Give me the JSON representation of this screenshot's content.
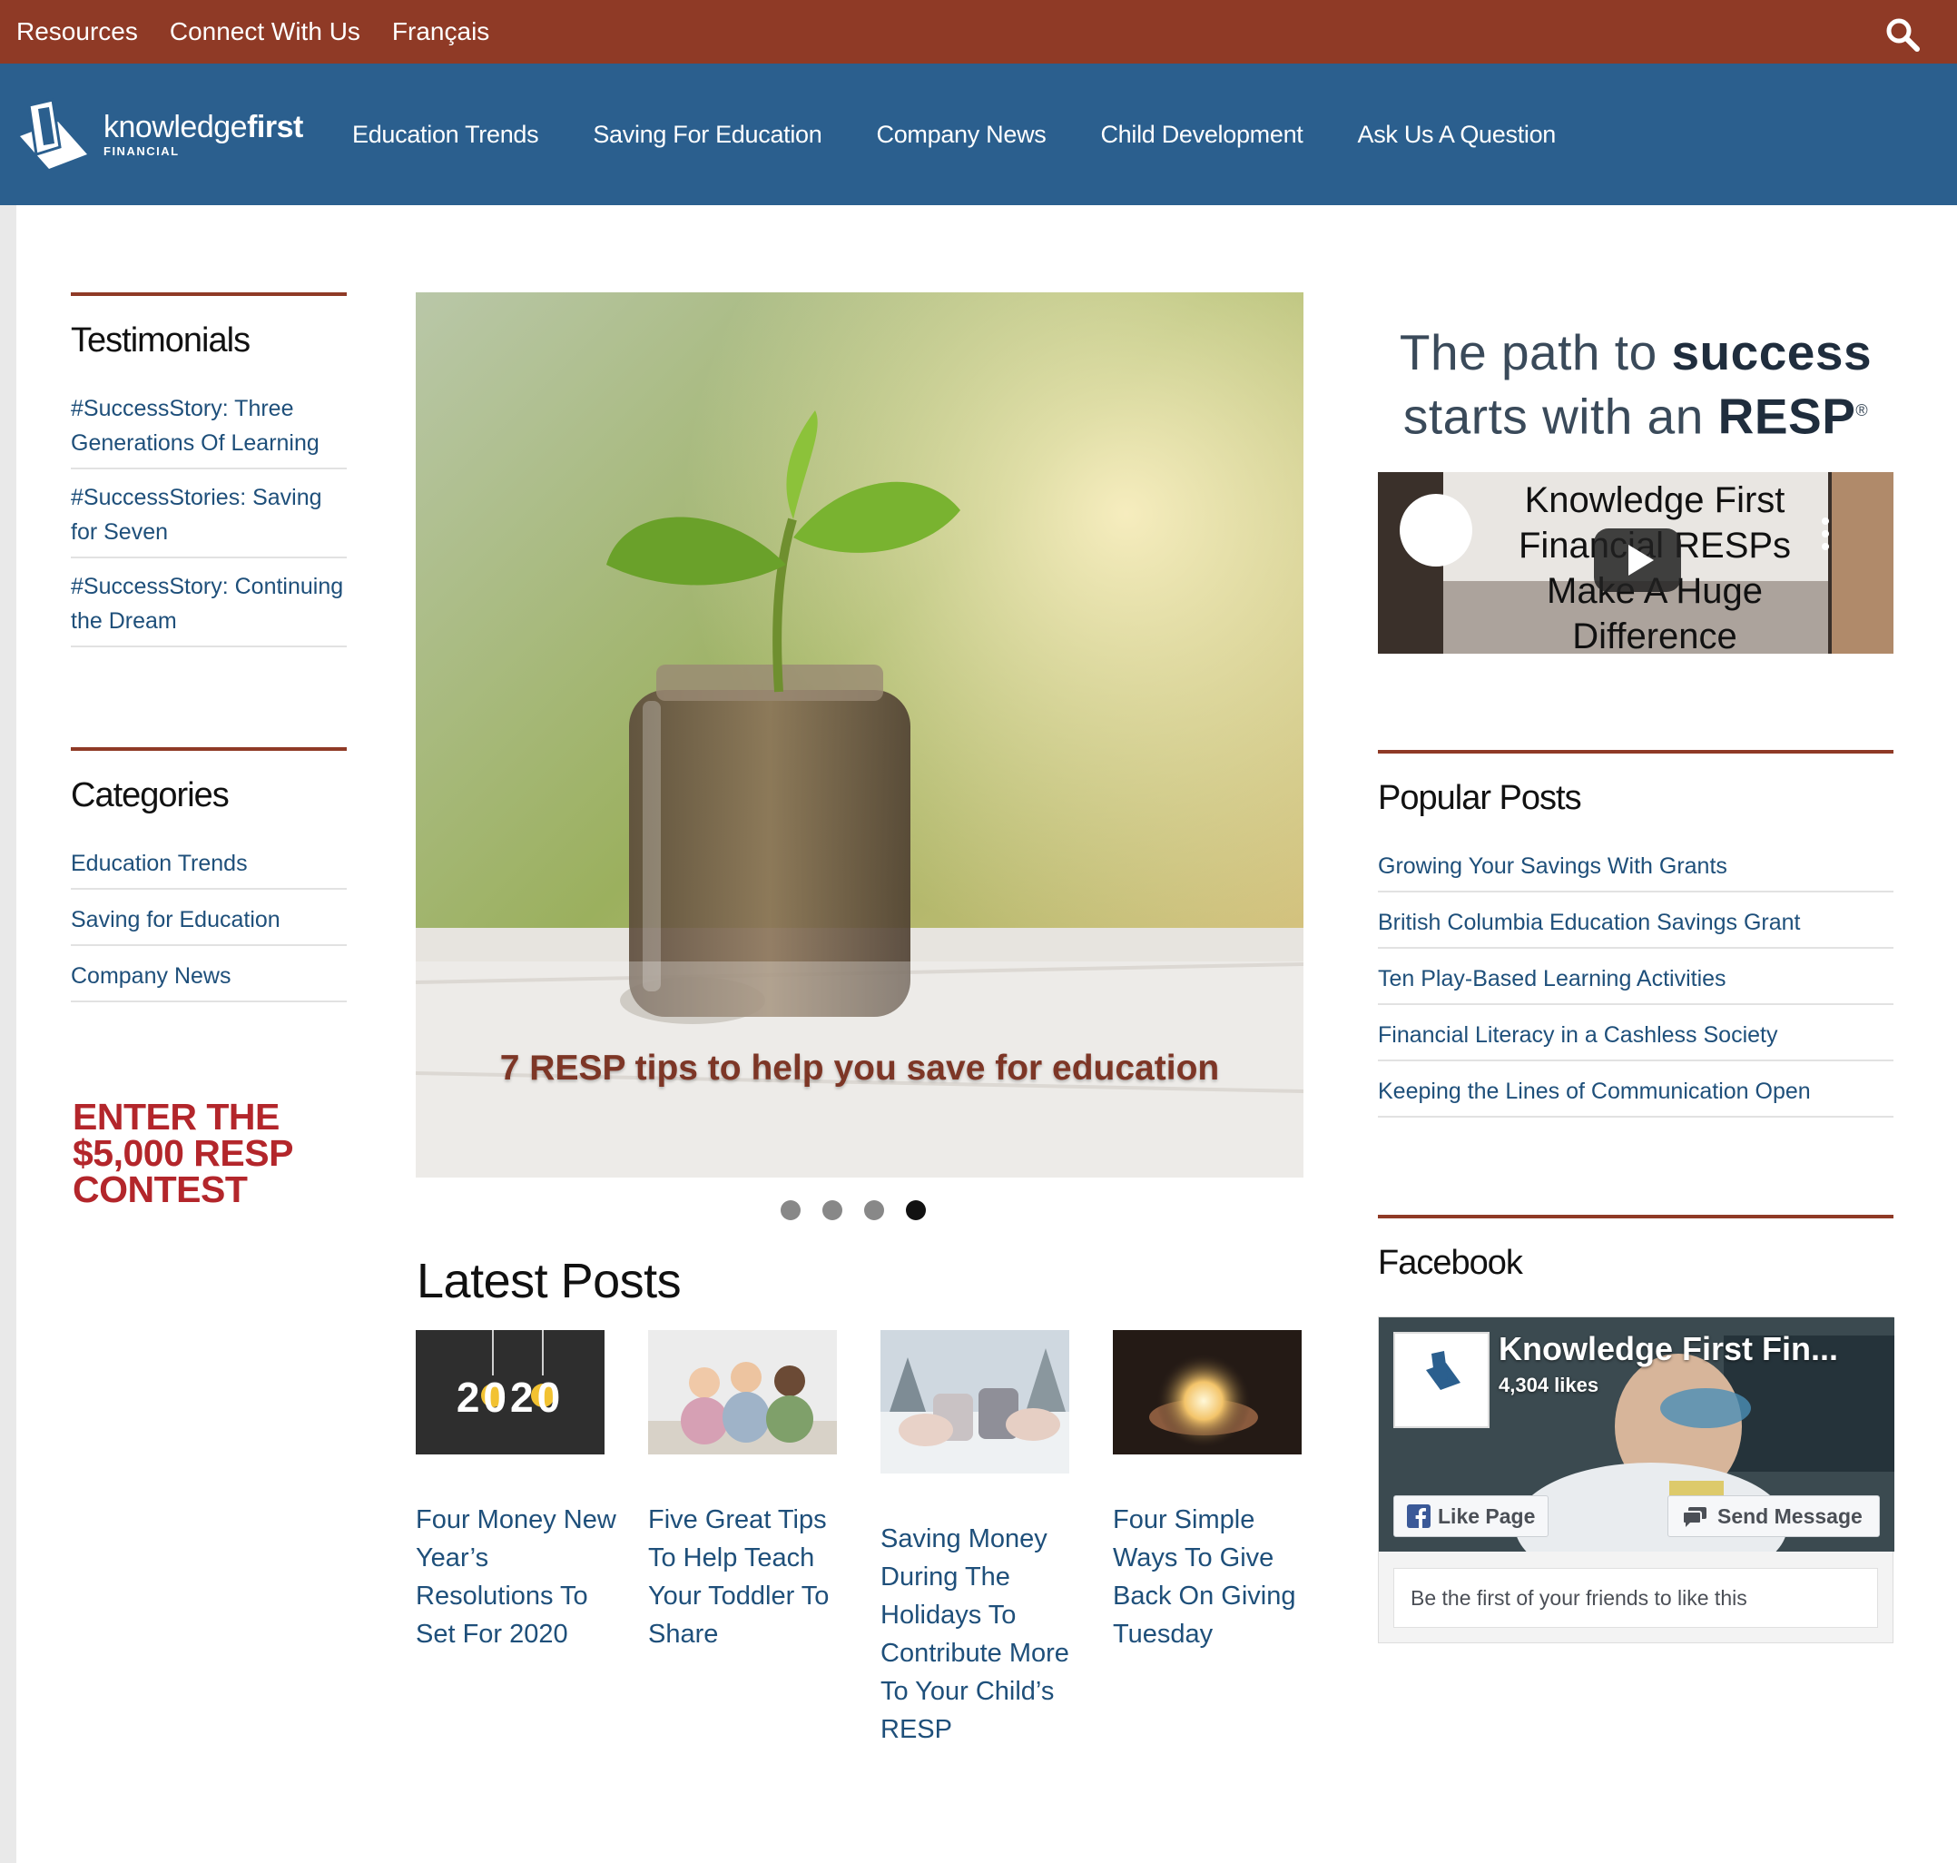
{
  "topbar": {
    "links": [
      "Resources",
      "Connect With Us",
      "Français"
    ],
    "search_icon": "search-icon"
  },
  "logo": {
    "brand_light": "knowledge",
    "brand_bold": "first",
    "sub": "FINANCIAL"
  },
  "nav": [
    "Education Trends",
    "Saving For Education",
    "Company News",
    "Child Development",
    "Ask Us A Question"
  ],
  "left": {
    "testimonials": {
      "title": "Testimonials",
      "items": [
        "#SuccessStory: Three Generations Of Learning",
        "#SuccessStories: Saving for Seven",
        "#SuccessStory: Continuing the Dream"
      ]
    },
    "categories": {
      "title": "Categories",
      "items": [
        "Education Trends",
        "Saving for Education",
        "Company News"
      ]
    },
    "contest": "ENTER THE $5,000 RESP CONTEST"
  },
  "slider": {
    "caption": "7 RESP tips to help you save for education",
    "dots": 4,
    "active": 4
  },
  "latest": {
    "title": "Latest Posts",
    "thumb_text": "2020",
    "posts": [
      "Four Money New Year’s Resolutions To Set For 2020",
      "Five Great Tips To Help Teach Your Toddler To Share",
      "Saving Money During The Holidays To Contribute More To Your Child’s RESP",
      "Four Simple Ways To Give Back On Giving Tuesday"
    ]
  },
  "right": {
    "tagline": {
      "l1a": "The path to ",
      "l1b": "success",
      "l2a": "starts with an ",
      "l2b": "RESP",
      "reg": "®"
    },
    "video": {
      "title": "Knowledge First Financial RESPs Make A Huge Difference"
    },
    "popular": {
      "title": "Popular Posts",
      "items": [
        "Growing Your Savings With Grants",
        "British Columbia Education Savings Grant",
        "Ten Play-Based Learning Activities",
        "Financial Literacy in a Cashless Society",
        "Keeping the Lines of Communication Open"
      ]
    },
    "facebook": {
      "title": "Facebook",
      "page_name": "Knowledge First Fin...",
      "likes": "4,304 likes",
      "like_btn": "Like Page",
      "msg_btn": "Send Message",
      "friends": "Be the first of your friends to like this"
    }
  },
  "colors": {
    "topbar": "#8f3a26",
    "nav": "#2b5f8e",
    "link": "#1e4f7a",
    "contest": "#b3262b"
  }
}
